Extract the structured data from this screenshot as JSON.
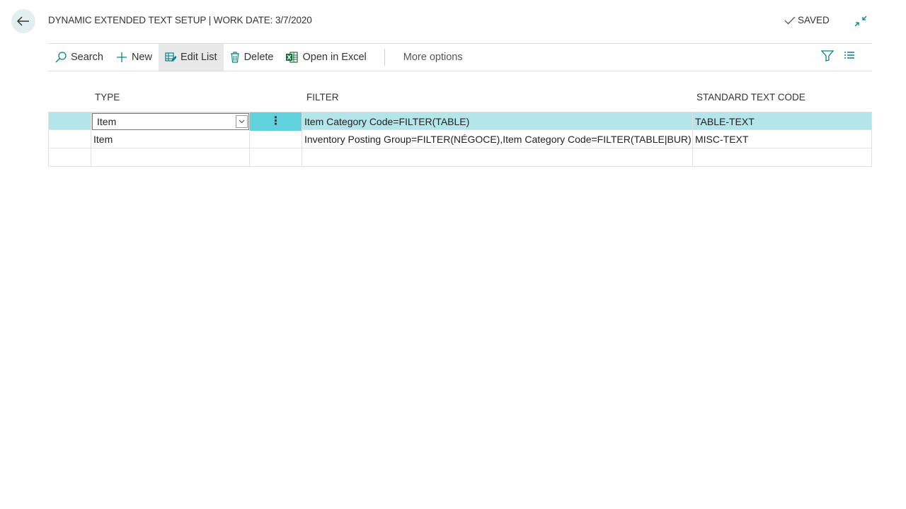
{
  "header": {
    "title": "DYNAMIC EXTENDED TEXT SETUP | WORK DATE: 3/7/2020",
    "saved_label": "SAVED"
  },
  "toolbar": {
    "search_label": "Search",
    "new_label": "New",
    "edit_list_label": "Edit List",
    "delete_label": "Delete",
    "open_excel_label": "Open in Excel",
    "more_options_label": "More options"
  },
  "table": {
    "columns": [
      "TYPE",
      "FILTER",
      "STANDARD TEXT CODE"
    ],
    "rows": [
      {
        "type": "Item",
        "filter": "Item Category Code=FILTER(TABLE)",
        "code": "TABLE-TEXT",
        "selected": true
      },
      {
        "type": "Item",
        "filter": "Inventory Posting Group=FILTER(NÉGOCE),Item Category Code=FILTER(TABLE|BUR)",
        "code": "MISC-TEXT",
        "selected": false
      },
      {
        "type": "",
        "filter": "",
        "code": "",
        "selected": false
      }
    ]
  },
  "colors": {
    "accent": "#008489",
    "selected_row": "#b3e5ea",
    "selected_cell": "#5fd2dd"
  }
}
